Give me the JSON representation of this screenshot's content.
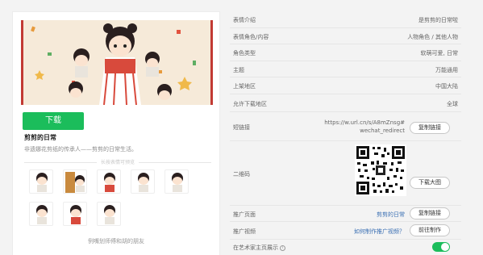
{
  "left": {
    "download_label": "下载",
    "title": "剪剪的日常",
    "description": "非遗娜花剪纸的传承人——剪剪的日常生活。",
    "divider_text": "长按表情可预览",
    "footer": "例嘴划师傅和胡的朋友",
    "thumb_captions": [
      "",
      "",
      "",
      "",
      "",
      "",
      "",
      ""
    ]
  },
  "details": {
    "intro_label": "表情介绍",
    "intro_value": "是剪剪的日常啦",
    "role_label": "表情角色/内容",
    "role_value": "人物角色 / 其他人物",
    "type_label": "角色类型",
    "type_value": "软萌可爱, 日常",
    "theme_label": "主题",
    "theme_value": "万能通用",
    "region_label": "上架地区",
    "region_value": "中国大陆",
    "allowed_label": "允许下载地区",
    "allowed_value": "全球",
    "shortlink_label": "短链接",
    "shortlink_line1": "https://w.url.cn/s/A8mZnsg#",
    "shortlink_line2": "wechat_redirect",
    "copy_link_label": "复制链接",
    "qrcode_label": "二维码",
    "download_qr_label": "下载大图",
    "promo_page_label": "推广页面",
    "promo_page_value": "剪剪的日常",
    "copy_link_label2": "复制链接",
    "promo_video_label": "推广视频",
    "promo_video_value": "如何制作推广视频？",
    "go_make_label": "前往制作",
    "art_display_label": "在艺术家主页展示",
    "art_display_on": true
  },
  "colors": {
    "accent": "#1bbd5b",
    "link": "#3a6fb3",
    "banner_border": "#c23a33"
  }
}
